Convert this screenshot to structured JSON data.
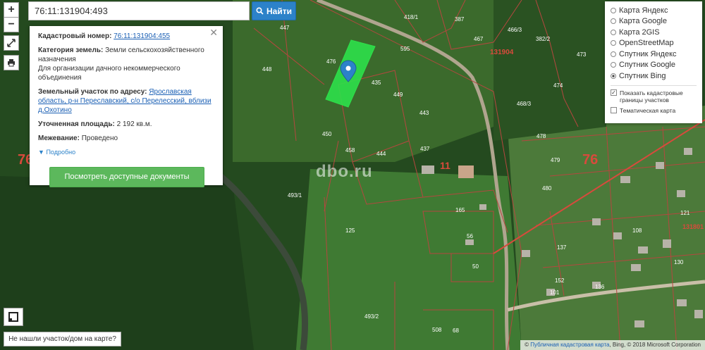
{
  "search": {
    "value": "76:11:131904:493",
    "button_label": "Найти"
  },
  "controls": {
    "zoom_in": "+",
    "zoom_out": "−"
  },
  "popup": {
    "cadastral_label": "Кадастровый номер:",
    "cadastral_value": "76:11:131904:455",
    "category_label": "Категория земель:",
    "category_value": "Земли сельскохозяйственного назначения",
    "purpose": "Для организации дачного некоммерческого объединения",
    "address_label": "Земельный участок по адресу:",
    "address_value": "Ярославская область, р-н Переславский, с/о Перелесский, вблизи д.Охотино",
    "area_label": "Уточненная площадь:",
    "area_value": "2 192 кв.м.",
    "survey_label": "Межевание:",
    "survey_value": "Проведено",
    "more_label": "Подробно",
    "docs_button": "Посмотреть доступные документы"
  },
  "layers": {
    "options": [
      {
        "label": "Карта Яндекс",
        "selected": false
      },
      {
        "label": "Карта Google",
        "selected": false
      },
      {
        "label": "Карта 2GIS",
        "selected": false
      },
      {
        "label": "OpenStreetMap",
        "selected": false
      },
      {
        "label": "Спутник Яндекс",
        "selected": false
      },
      {
        "label": "Спутник Google",
        "selected": false
      },
      {
        "label": "Спутник Bing",
        "selected": true
      }
    ],
    "show_borders_label": "Показать кадастровые границы участков",
    "show_borders_checked": true,
    "thematic_label": "Тематическая карта",
    "thematic_checked": false
  },
  "map": {
    "parcel_labels": [
      "447",
      "418/1",
      "387",
      "467",
      "466/3",
      "382/2",
      "595",
      "473",
      "448",
      "435",
      "449",
      "474",
      "468/3",
      "443",
      "476",
      "450",
      "478",
      "458",
      "444",
      "437",
      "479",
      "480",
      "493/1",
      "165",
      "121",
      "125",
      "56",
      "108",
      "137",
      "130",
      "50",
      "152",
      "136",
      "101",
      "493/2",
      "508",
      "68"
    ],
    "block_numbers": [
      "131904",
      "76",
      "76",
      "11",
      "131904",
      "131801"
    ],
    "watermark": "dbo.ru"
  },
  "bottom": {
    "not_found": "Не нашли участок/дом на карте?",
    "attribution_link": "Публичная кадастровая карта",
    "attribution_text": ", Bing, © 2018 Microsoft Corporation"
  },
  "colors": {
    "parcel_border": "#b5473f",
    "selected_parcel": "#2ee04a",
    "marker": "#2c82c9",
    "search_button": "#2c82c9",
    "docs_button": "#5cb85c"
  }
}
